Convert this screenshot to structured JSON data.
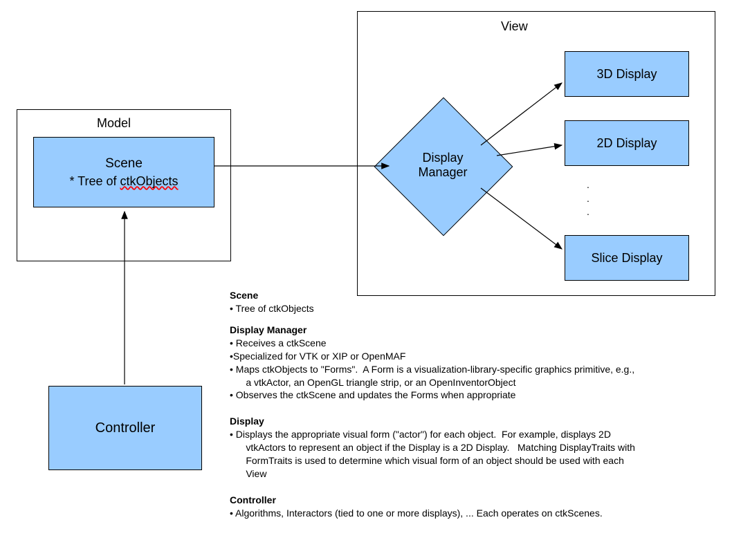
{
  "model": {
    "label": "Model",
    "scene": {
      "title": "Scene",
      "subtitle_prefix": "* Tree of ",
      "subtitle_misspelled": "ctkObjects"
    }
  },
  "view": {
    "label": "View",
    "displayManager": {
      "line1": "Display",
      "line2": "Manager"
    },
    "displays": {
      "d3d": "3D Display",
      "d2d": "2D Display",
      "slice": "Slice Display"
    }
  },
  "controller": {
    "label": "Controller"
  },
  "notes": {
    "scene": {
      "heading": "Scene",
      "bullets": [
        "Tree of ctkObjects"
      ]
    },
    "displayManager": {
      "heading": "Display Manager",
      "bullets": [
        "Receives a ctkScene",
        "Specialized for VTK or XIP or OpenMAF",
        "Maps ctkObjects to \"Forms\".  A Form is a visualization-library-specific graphics primitive, e.g., a vtkActor, an OpenGL triangle strip, or an OpenInventorObject",
        "Observes the ctkScene and updates the Forms when appropriate"
      ]
    },
    "display": {
      "heading": "Display",
      "bullets": [
        "Displays the appropriate visual form (\"actor\") for each object.  For example, displays 2D vtkActors to represent an object if the Display is a 2D Display.   Matching DisplayTraits with FormTraits is used to determine which visual form of an object should be used with each View"
      ]
    },
    "controller": {
      "heading": "Controller",
      "bullets": [
        "Algorithms, Interactors (tied to one or more displays), ...  Each operates on ctkScenes."
      ]
    }
  }
}
